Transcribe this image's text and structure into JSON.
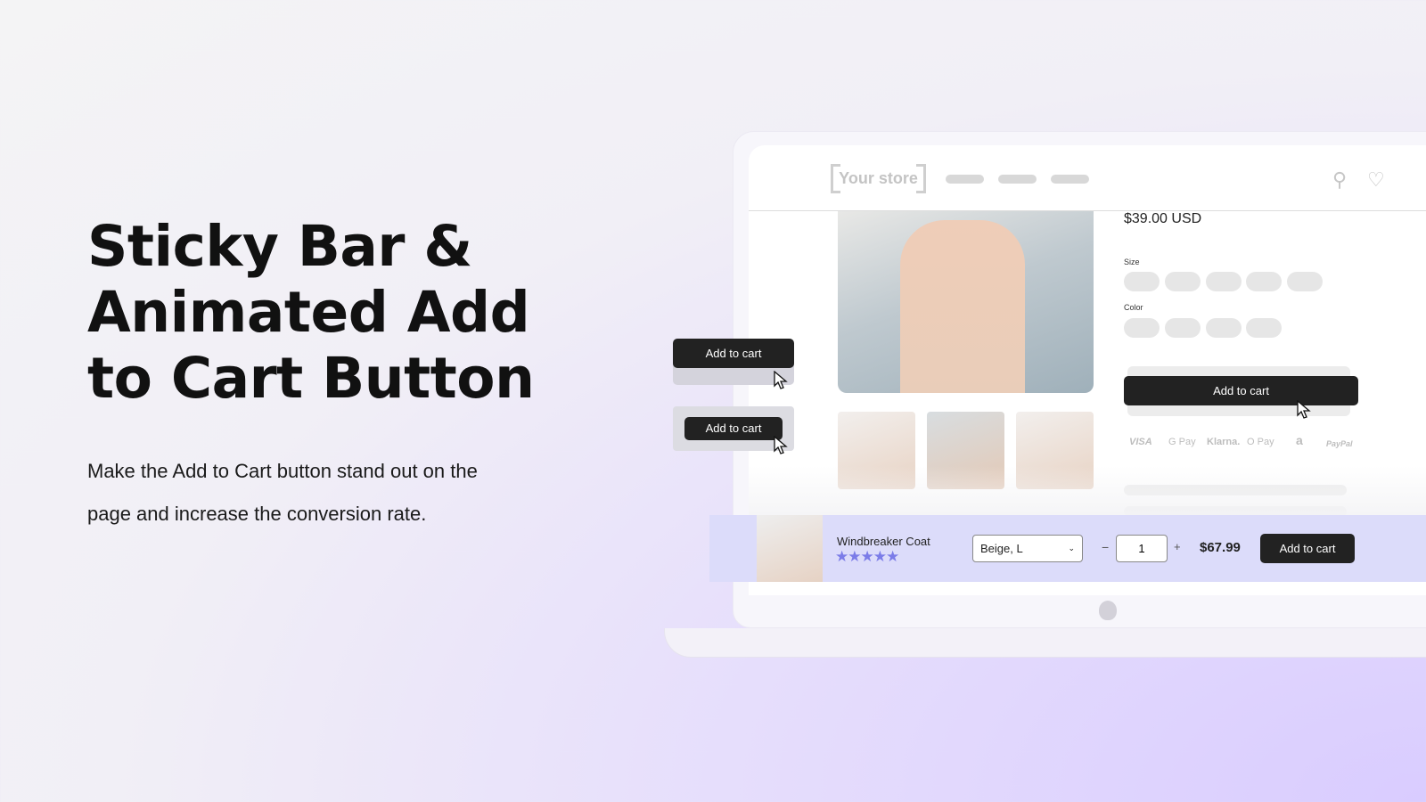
{
  "hero": {
    "title": "Sticky Bar & Animated Add to Cart Button",
    "subtitle": "Make the Add to Cart button stand out on the page and increase the conversion rate."
  },
  "store": {
    "logo": "Your store",
    "price": "$39.00 USD",
    "size_label": "Size",
    "color_label": "Color",
    "add_to_cart": "Add to cart",
    "payment_methods": [
      "VISA",
      "G Pay",
      "Klarna.",
      "O Pay",
      "a",
      "PayPal"
    ]
  },
  "floating_buttons": {
    "button1": "Add to cart",
    "button2": "Add to cart"
  },
  "sticky_bar": {
    "product_name": "Windbreaker Coat",
    "rating": 5,
    "stars": "★★★★★",
    "variant": "Beige, L",
    "minus": "−",
    "quantity": "1",
    "plus": "+",
    "price": "$67.99",
    "add_to_cart": "Add to cart",
    "star_color": "#7b7ce8",
    "bar_color": "#dcdcfa"
  }
}
